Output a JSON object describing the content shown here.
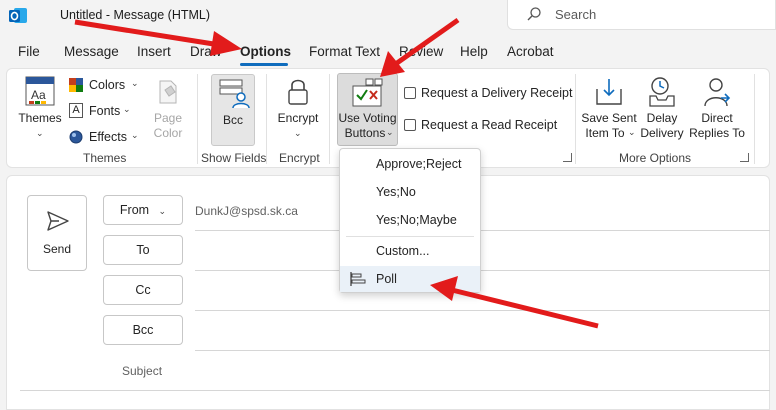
{
  "window": {
    "title": "Untitled  -  Message (HTML)"
  },
  "search": {
    "placeholder": "Search"
  },
  "menu": {
    "tabs": [
      "File",
      "Message",
      "Insert",
      "Draw",
      "Options",
      "Format Text",
      "Review",
      "Help",
      "Acrobat"
    ],
    "active": "Options"
  },
  "ribbon": {
    "themes": {
      "themes_label": "Themes",
      "colors_label": "Colors",
      "fonts_label": "Fonts",
      "effects_label": "Effects",
      "page_color_line1": "Page",
      "page_color_line2": "Color",
      "group": "Themes"
    },
    "show_fields": {
      "bcc_label": "Bcc",
      "group": "Show Fields"
    },
    "encrypt": {
      "label": "Encrypt",
      "group": "Encrypt"
    },
    "tracking": {
      "voting_line1": "Use Voting",
      "voting_line2": "Buttons",
      "delivery_receipt": "Request a Delivery Receipt",
      "read_receipt": "Request a Read Receipt"
    },
    "more_options": {
      "save_sent_line1": "Save Sent",
      "save_sent_line2": "Item To",
      "delay_line1": "Delay",
      "delay_line2": "Delivery",
      "direct_line1": "Direct",
      "direct_line2": "Replies To",
      "group": "More Options"
    }
  },
  "voting_menu": {
    "items": [
      "Approve;Reject",
      "Yes;No",
      "Yes;No;Maybe",
      "Custom...",
      "Poll"
    ]
  },
  "compose": {
    "send_label": "Send",
    "from_label": "From",
    "from_value": "DunkJ@spsd.sk.ca",
    "to_label": "To",
    "cc_label": "Cc",
    "bcc_label": "Bcc",
    "subject_label": "Subject"
  },
  "colors": {
    "accent": "#0f6cbd",
    "annotation": "#e21b1b"
  }
}
